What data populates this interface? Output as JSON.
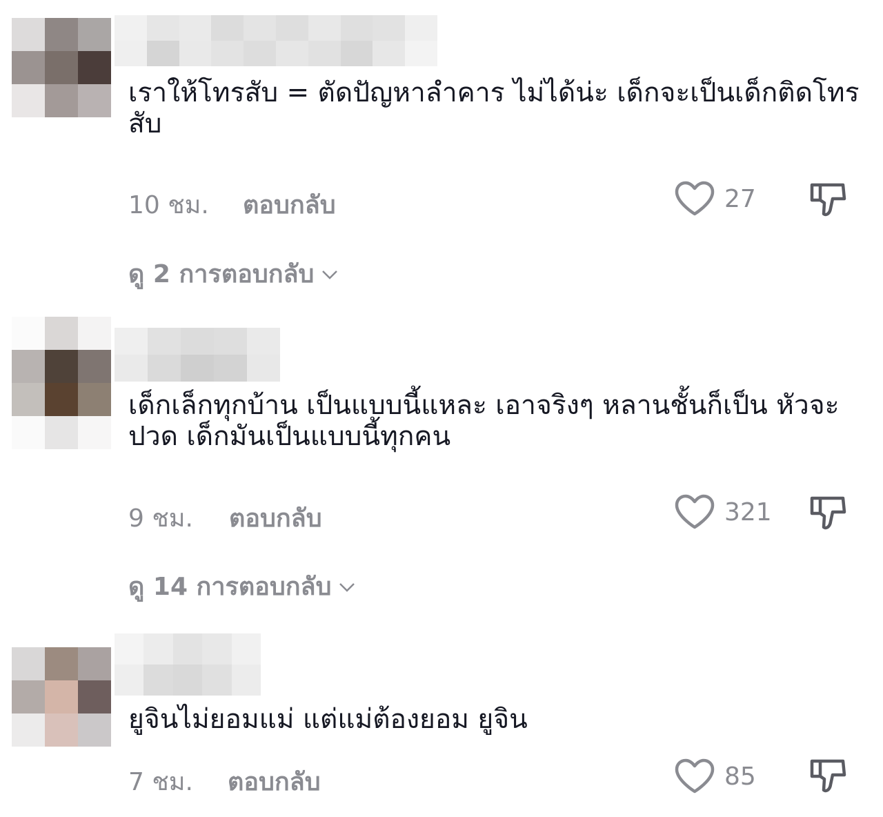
{
  "comments": [
    {
      "text": "เราให้โทรสับ = ตัดปัญหาลำคาร ไม่ได้น่ะ เด็กจะเป็นเด็กติดโทรสับ",
      "time": "10 ชม.",
      "reply_label": "ตอบกลับ",
      "likes": "27",
      "view_replies": "ดู 2 การตอบกลับ",
      "like_icon": "heart-outline",
      "dislike_icon": "thumbs-down-outline"
    },
    {
      "text": "เด็กเล็กทุกบ้าน เป็นแบบนี้แหละ เอาจริงๆ หลานชั้นก็เป็น หัวจะปวด เด็กมันเป็นแบบนี้ทุกคน",
      "time": "9 ชม.",
      "reply_label": "ตอบกลับ",
      "likes": "321",
      "view_replies": "ดู 14 การตอบกลับ",
      "like_icon": "heart-outline",
      "dislike_icon": "thumbs-down-outline"
    },
    {
      "text": "ยูจินไม่ยอมแม่ แต่แม่ต้องยอม ยูจิน",
      "time": "7 ชม.",
      "reply_label": "ตอบกลับ",
      "likes": "85",
      "like_icon": "heart-outline",
      "dislike_icon": "thumbs-down-outline"
    }
  ],
  "colors": {
    "text": "#161823",
    "muted": "#8a8b91"
  }
}
